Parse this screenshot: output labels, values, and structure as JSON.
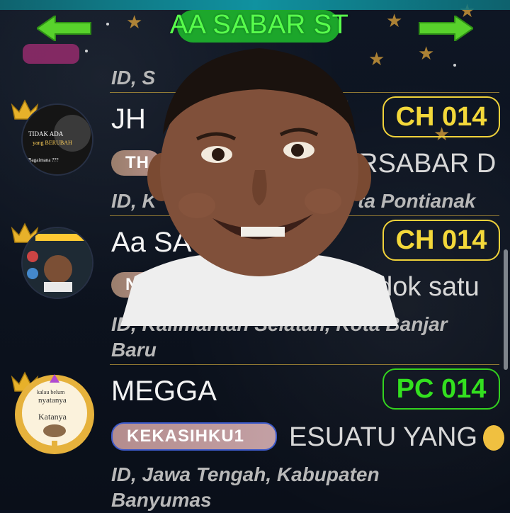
{
  "header": {
    "title": "AA SABAR ST"
  },
  "rows": [
    {
      "name": "JH",
      "badge": "CH 014",
      "tag": "TH",
      "motto": "RSABAR D",
      "location_line1": "ID, K",
      "location_line2": "ta Pontianak",
      "avatar_text_1": "TIDAK ADA",
      "avatar_text_2": "yang BERUBAH",
      "avatar_text_3": "Bagaimana ???"
    },
    {
      "name": "Aa SA",
      "badge": "CH 014",
      "tag": "NF",
      "motto": "ndok satu",
      "location_line1": "ID, Kalimantan Selatan, Kota Banjar",
      "location_line2": "Baru"
    },
    {
      "name": "MEGGA",
      "badge": "PC 014",
      "tag": "KEKASIHKU1",
      "motto": "ESUATU YANG",
      "location_line1": "ID, Jawa Tengah, Kabupaten",
      "location_line2": "Banyumas",
      "avatar_text_1": "kalau belum",
      "avatar_text_2": "nyatanya",
      "avatar_text_3": "Katanya"
    }
  ],
  "partial_top": {
    "location_line": "ID, S"
  },
  "colors": {
    "badge_ch": "#f3d83a",
    "badge_pc": "#33e01f",
    "title": "#58ff4c",
    "divider": "#c7a23b"
  },
  "icons": {
    "nav_left": "arrow-left-icon",
    "nav_right": "arrow-right-icon",
    "crown": "crown-icon"
  }
}
